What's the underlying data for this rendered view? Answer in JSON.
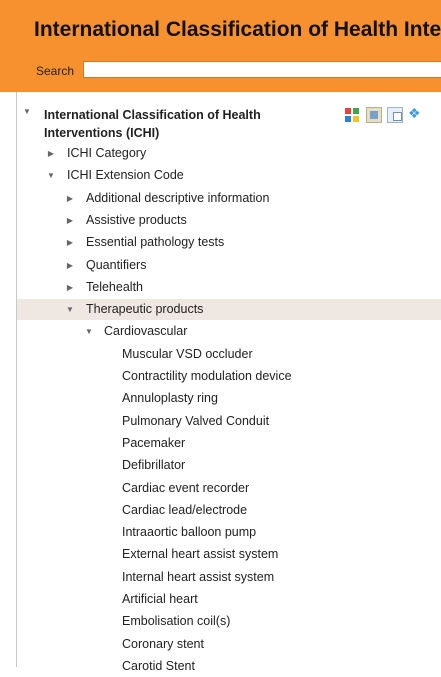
{
  "header": {
    "title": "International Classification of Health Interventions",
    "search_label": "Search",
    "search_value": ""
  },
  "colors": {
    "header_bg": "#f7912f",
    "selected_row_bg": "#efe7e1"
  },
  "toolbar": {
    "icons": [
      "color-grid-icon",
      "person-icon",
      "copy-icon",
      "network-icon"
    ]
  },
  "tree": {
    "root": {
      "label": "International Classification of Health Interventions (ICHI)",
      "expanded": true
    },
    "nodes": [
      {
        "label": "ICHI Category",
        "level": 1,
        "expander": "collapsed"
      },
      {
        "label": "ICHI Extension Code",
        "level": 1,
        "expander": "expanded"
      },
      {
        "label": "Additional descriptive information",
        "level": 2,
        "expander": "collapsed"
      },
      {
        "label": "Assistive products",
        "level": 2,
        "expander": "collapsed"
      },
      {
        "label": "Essential pathology tests",
        "level": 2,
        "expander": "collapsed"
      },
      {
        "label": "Quantifiers",
        "level": 2,
        "expander": "collapsed"
      },
      {
        "label": "Telehealth",
        "level": 2,
        "expander": "collapsed"
      },
      {
        "label": "Therapeutic products",
        "level": 2,
        "expander": "expanded",
        "selected": true
      },
      {
        "label": "Cardiovascular",
        "level": 3,
        "expander": "expanded"
      },
      {
        "label": "Muscular VSD occluder",
        "level": 4,
        "expander": "none"
      },
      {
        "label": "Contractility modulation device",
        "level": 4,
        "expander": "none"
      },
      {
        "label": "Annuloplasty ring",
        "level": 4,
        "expander": "none"
      },
      {
        "label": "Pulmonary Valved Conduit",
        "level": 4,
        "expander": "none"
      },
      {
        "label": "Pacemaker",
        "level": 4,
        "expander": "none"
      },
      {
        "label": "Defibrillator",
        "level": 4,
        "expander": "none"
      },
      {
        "label": "Cardiac event recorder",
        "level": 4,
        "expander": "none"
      },
      {
        "label": "Cardiac lead/electrode",
        "level": 4,
        "expander": "none"
      },
      {
        "label": "Intraaortic balloon pump",
        "level": 4,
        "expander": "none"
      },
      {
        "label": "External heart assist system",
        "level": 4,
        "expander": "none"
      },
      {
        "label": "Internal heart assist system",
        "level": 4,
        "expander": "none"
      },
      {
        "label": "Artificial heart",
        "level": 4,
        "expander": "none"
      },
      {
        "label": "Embolisation coil(s)",
        "level": 4,
        "expander": "none"
      },
      {
        "label": "Coronary stent",
        "level": 4,
        "expander": "none"
      },
      {
        "label": "Carotid Stent",
        "level": 4,
        "expander": "none"
      }
    ]
  }
}
